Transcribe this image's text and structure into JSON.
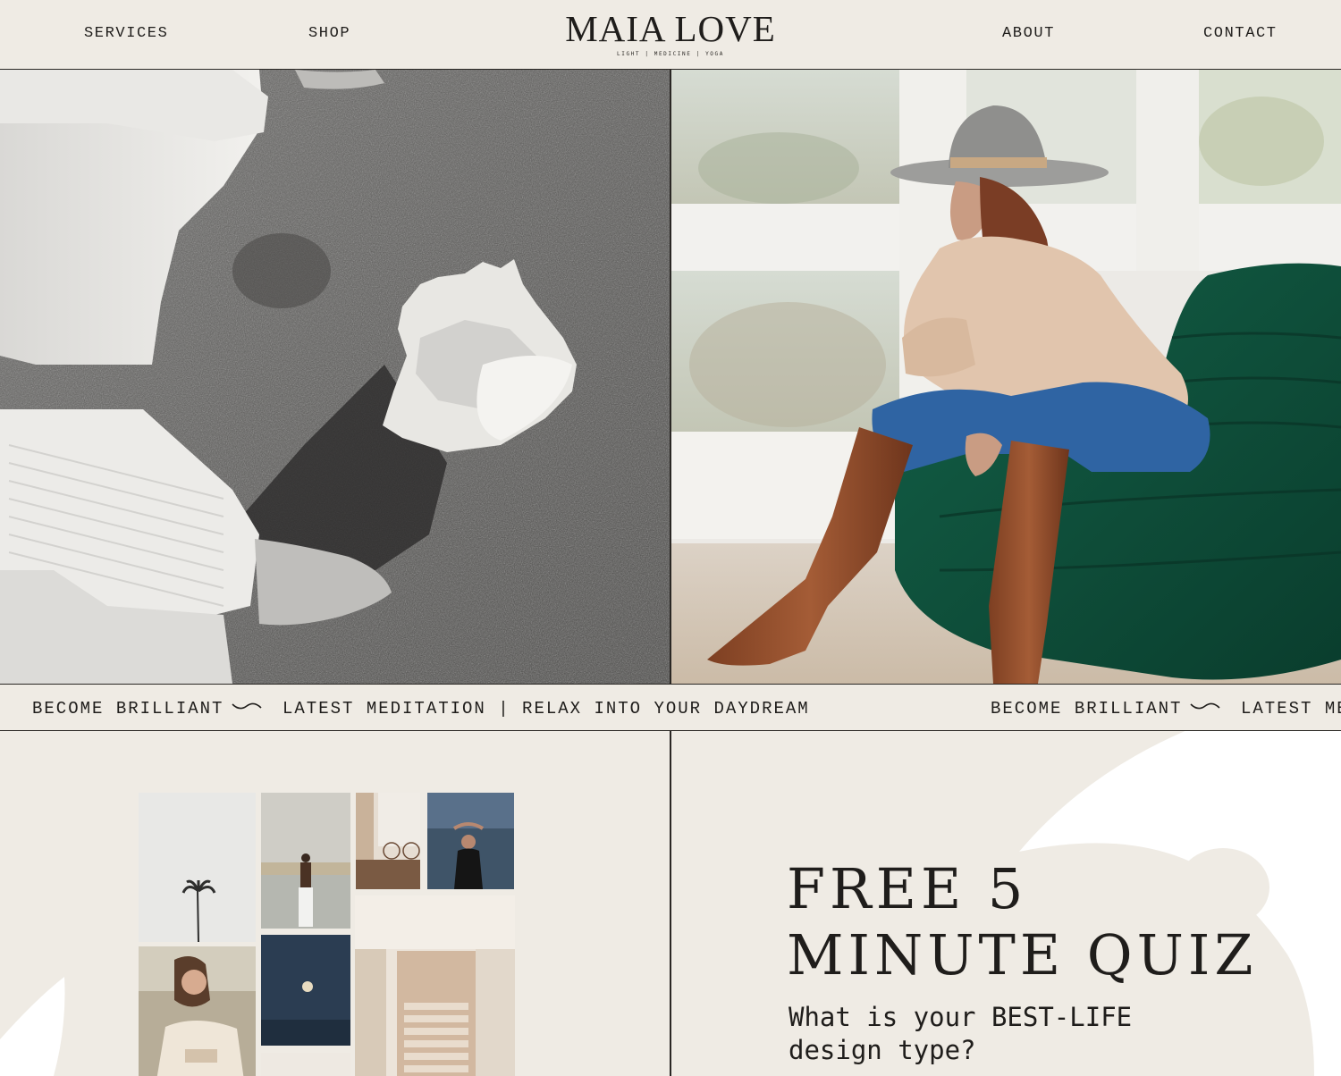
{
  "nav": {
    "services": "SERVICES",
    "shop": "SHOP",
    "about": "ABOUT",
    "contact": "CONTACT"
  },
  "logo": {
    "name": "MAIA LOVE",
    "tagline": "LIGHT | MEDICINE | YOGA"
  },
  "marquee": {
    "item1": "BECOME BRILLIANT",
    "item2": "LATEST MEDITATION | RELAX INTO YOUR DAYDREAM",
    "item3": "BECOME BRILLIANT",
    "item4": "LATEST MEDITATION | RELAX INTO YOUR DAYDREAM"
  },
  "quiz": {
    "title_line1": "FREE 5",
    "title_line2": "MINUTE QUIZ",
    "subtitle": "What is your BEST-LIFE design type?"
  },
  "colors": {
    "background": "#efebe4",
    "text": "#1f1d1b",
    "line": "#2a2724",
    "leaf": "#ffffff",
    "sofa": "#0f4a38"
  },
  "icons": {
    "wave": "wave-divider-icon"
  }
}
